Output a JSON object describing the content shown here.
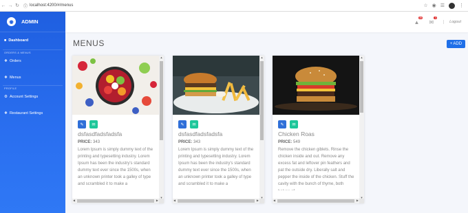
{
  "browser": {
    "url": "localhost:4200/#/menus"
  },
  "sidebar": {
    "brand": "ADMIN",
    "dashboard": "Dashboard",
    "section_orders": "ORDERS & MENUS",
    "orders": "Orders",
    "menus": "Menus",
    "section_profile": "PROFILE",
    "account": "Account Settings",
    "restaurant": "Restaurant Settings"
  },
  "topbar": {
    "badge1": "35",
    "badge2": "3",
    "logout": "Logout"
  },
  "page": {
    "title": "MENUS",
    "add": "ADD"
  },
  "cards": [
    {
      "name": "dsfasdfadsfadsfa",
      "price_label": "PRICE:",
      "price": "343",
      "description": "Lorem Ipsum is simply dummy text of the printing and typesetting industry. Lorem Ipsum has been the industry's standard dummy text ever since the 1500s, when an unknown printer took a galley of type and scrambled it to make a"
    },
    {
      "name": "dsfasdfadsfadsfa",
      "price_label": "PRICE:",
      "price": "343",
      "description": "Lorem Ipsum is simply dummy text of the printing and typesetting industry. Lorem Ipsum has been the industry's standard dummy text ever since the 1500s, when an unknown printer took a galley of type and scrambled it to make a"
    },
    {
      "name": "Chicken Roas",
      "price_label": "PRICE:",
      "price": "549",
      "description": "Remove the chicken giblets. Rinse the chicken inside and out. Remove any excess fat and leftover pin feathers and pat the outside dry. Liberally salt and pepper the inside of the chicken. Stuff the cavity with the bunch of thyme, both halves of"
    }
  ],
  "icons": {
    "brand": "chef-hat-icon",
    "dashboard": "dashboard-icon",
    "orders": "cutlery-icon",
    "menus": "cutlery-icon",
    "account": "gear-icon",
    "restaurant": "cutlery-icon",
    "edit": "edit-icon",
    "delete": "message-icon"
  },
  "colors": {
    "primary": "#1f6fe8",
    "edit": "#2f6fd8",
    "delete": "#1ec79a"
  }
}
